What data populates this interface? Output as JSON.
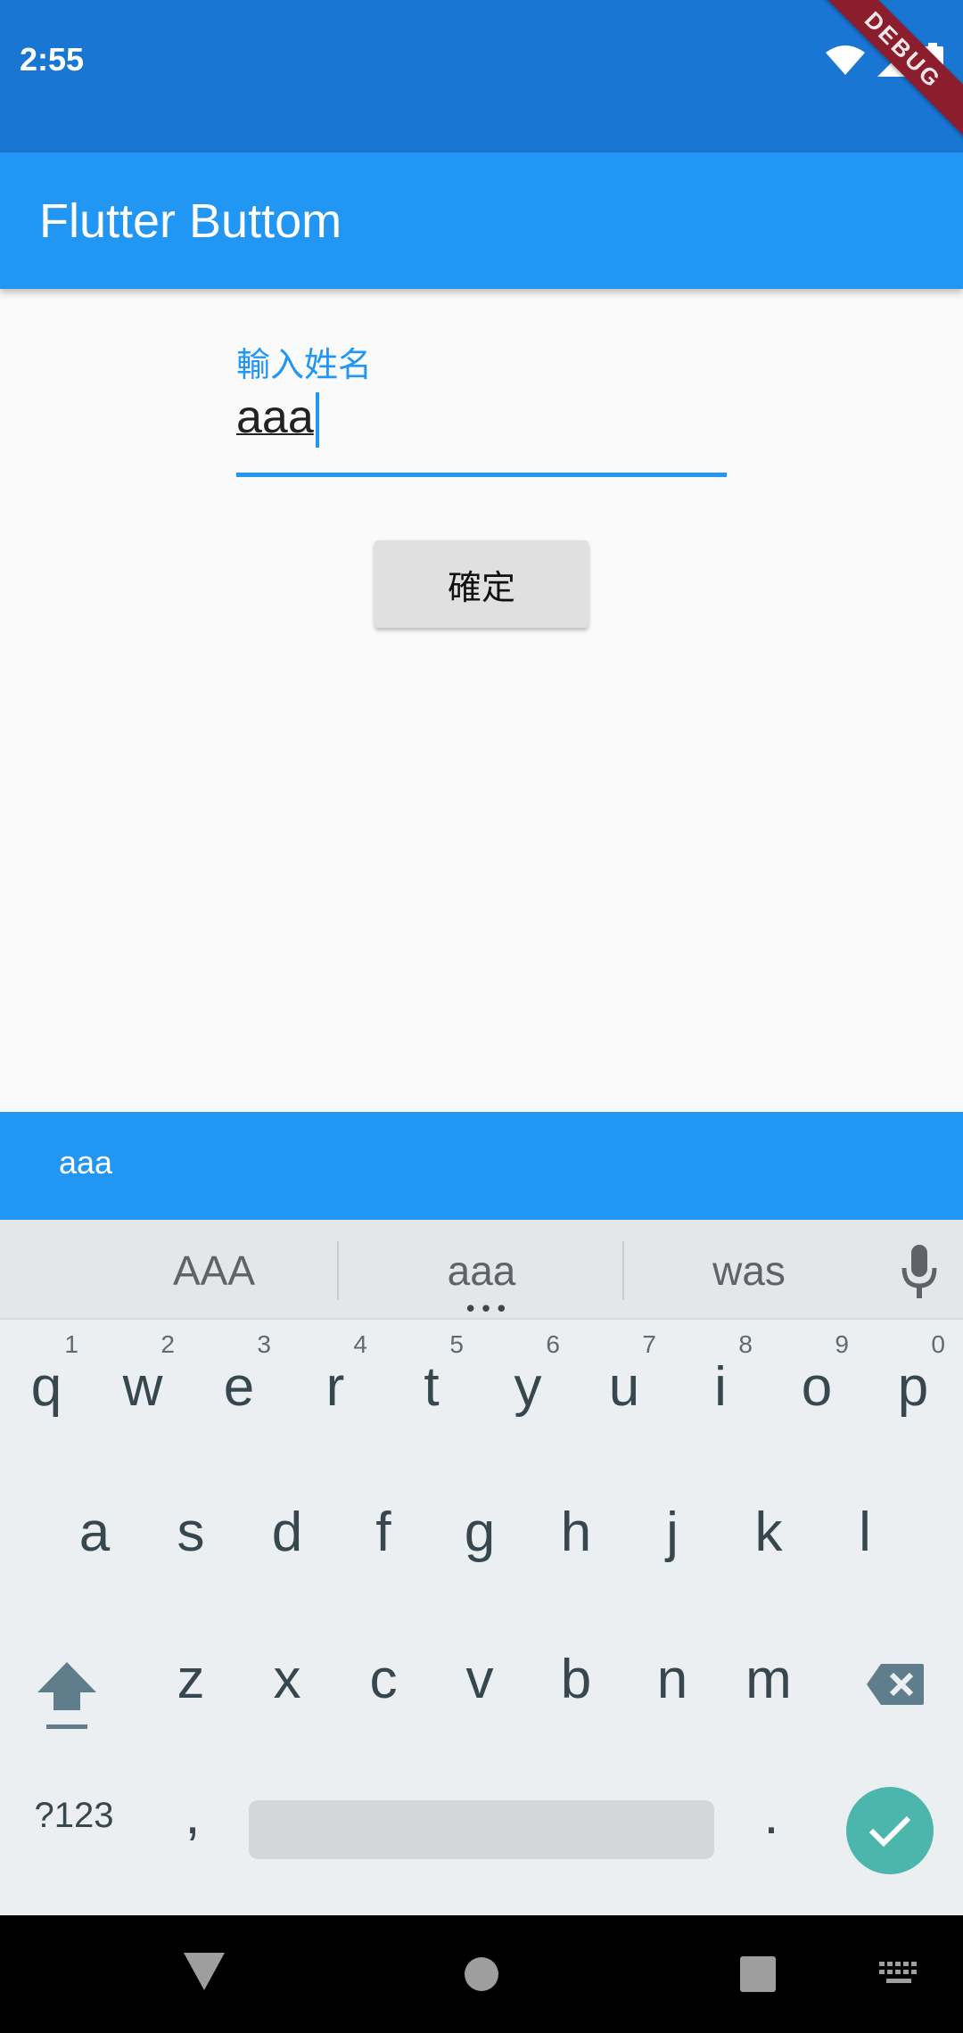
{
  "status_bar": {
    "time": "2:55",
    "debug_label": "DEBUG"
  },
  "app_bar": {
    "title": "Flutter Buttom"
  },
  "form": {
    "name_label": "輸入姓名",
    "name_value": "aaa",
    "confirm_label": "確定"
  },
  "bottom_bar": {
    "text": "aaa"
  },
  "keyboard": {
    "suggestions": [
      "AAA",
      "aaa",
      "was"
    ],
    "row1": [
      {
        "letter": "q",
        "num": "1"
      },
      {
        "letter": "w",
        "num": "2"
      },
      {
        "letter": "e",
        "num": "3"
      },
      {
        "letter": "r",
        "num": "4"
      },
      {
        "letter": "t",
        "num": "5"
      },
      {
        "letter": "y",
        "num": "6"
      },
      {
        "letter": "u",
        "num": "7"
      },
      {
        "letter": "i",
        "num": "8"
      },
      {
        "letter": "o",
        "num": "9"
      },
      {
        "letter": "p",
        "num": "0"
      }
    ],
    "row2": [
      "a",
      "s",
      "d",
      "f",
      "g",
      "h",
      "j",
      "k",
      "l"
    ],
    "row3": [
      "z",
      "x",
      "c",
      "v",
      "b",
      "n",
      "m"
    ],
    "symbols_label": "?123",
    "comma": ",",
    "period": "."
  },
  "colors": {
    "status_bar": "#1976d2",
    "app_bar": "#2196f3",
    "accent": "#2196f3",
    "enter_key": "#4db6ac",
    "debug_ribbon": "#8b1d2c"
  },
  "icons": [
    "wifi-icon",
    "signal-icon",
    "battery-icon",
    "mic-icon",
    "shift-icon",
    "backspace-icon",
    "check-icon",
    "back-icon",
    "home-icon",
    "recents-icon",
    "keyboard-switch-icon"
  ]
}
